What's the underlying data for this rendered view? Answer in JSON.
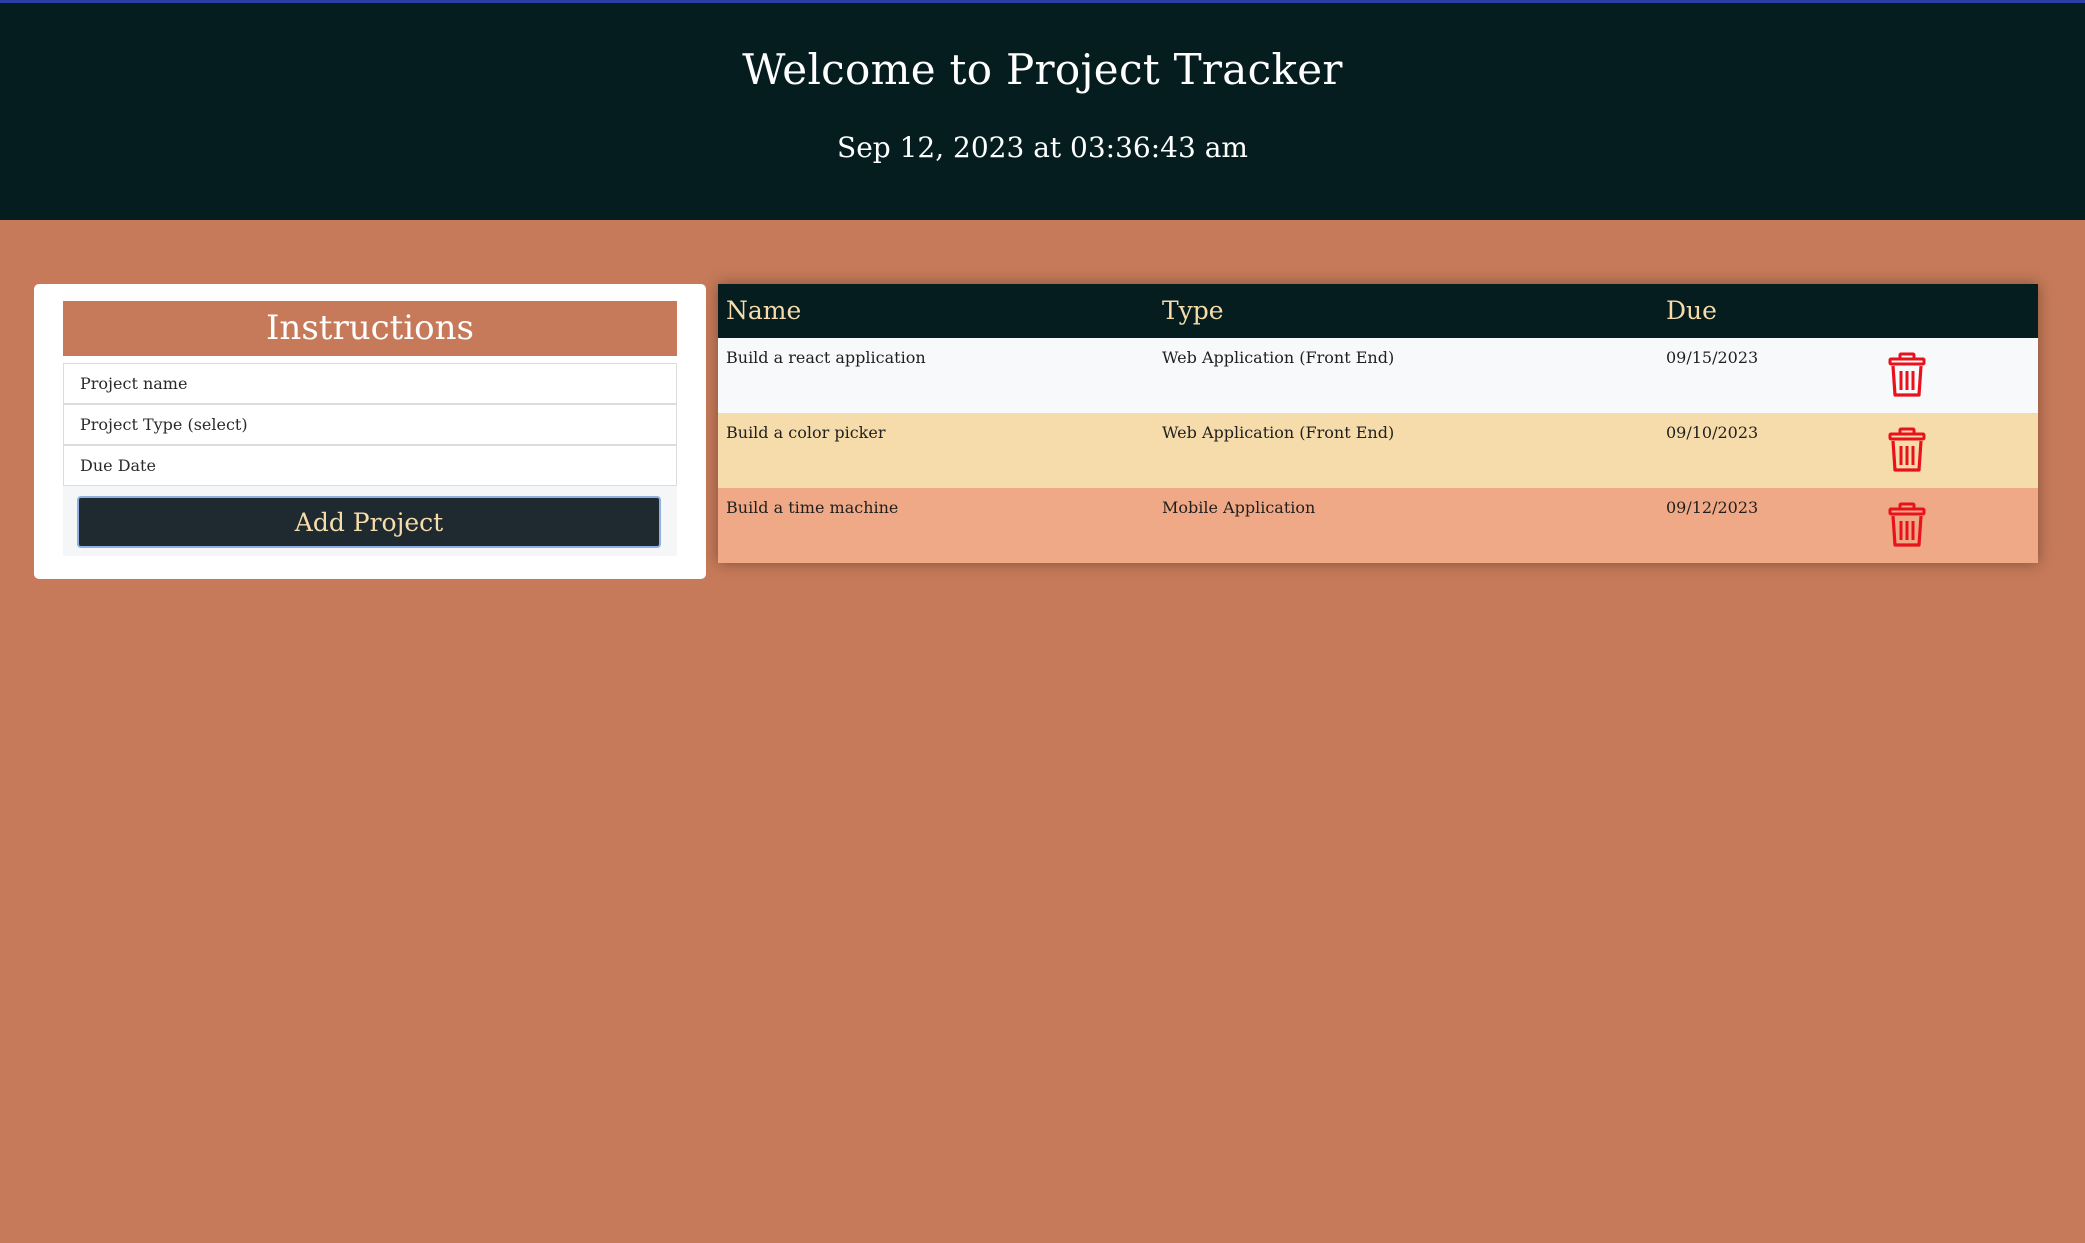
{
  "header": {
    "title": "Welcome to Project Tracker",
    "datetime": "Sep 12, 2023 at 03:36:43 am"
  },
  "form": {
    "banner": "Instructions",
    "project_name_placeholder": "Project name",
    "project_type_placeholder": "Project Type (select)",
    "due_date_placeholder": "Due Date",
    "submit_label": "Add Project"
  },
  "table": {
    "columns": [
      "Name",
      "Type",
      "Due"
    ],
    "rows": [
      {
        "name": "Build a react application",
        "type": "Web Application (Front End)",
        "due": "09/15/2023"
      },
      {
        "name": "Build a color picker",
        "type": "Web Application (Front End)",
        "due": "09/10/2023"
      },
      {
        "name": "Build a time machine",
        "type": "Mobile Application",
        "due": "09/12/2023"
      }
    ],
    "row_colors": [
      "#f8f9fa",
      "#f6dcab",
      "#f0a987"
    ],
    "delete_icon": "trash-icon"
  },
  "colors": {
    "background": "#c67a59",
    "header_bg": "#061d1f",
    "accent_text": "#f6dcab",
    "delete": "#e8121c"
  }
}
